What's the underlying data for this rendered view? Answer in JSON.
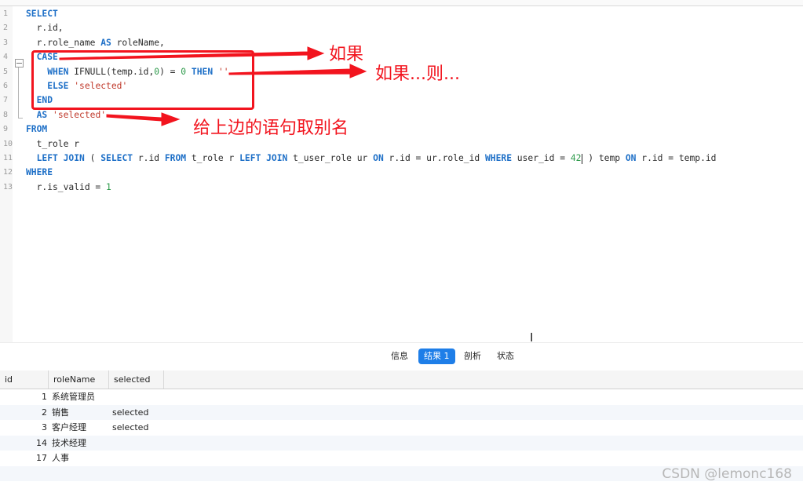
{
  "editor": {
    "lines": [
      {
        "n": "1",
        "segs": [
          {
            "t": "SELECT",
            "c": "kw"
          }
        ]
      },
      {
        "n": "2",
        "segs": [
          {
            "t": "  r.id,",
            "c": ""
          }
        ]
      },
      {
        "n": "3",
        "segs": [
          {
            "t": "  r.role_name ",
            "c": ""
          },
          {
            "t": "AS",
            "c": "kw"
          },
          {
            "t": " roleName,",
            "c": ""
          }
        ]
      },
      {
        "n": "4",
        "segs": [
          {
            "t": "  ",
            "c": ""
          },
          {
            "t": "CASE",
            "c": "kw"
          }
        ]
      },
      {
        "n": "5",
        "segs": [
          {
            "t": "    ",
            "c": ""
          },
          {
            "t": "WHEN",
            "c": "kw"
          },
          {
            "t": " IFNULL(temp.id,",
            "c": ""
          },
          {
            "t": "0",
            "c": "num"
          },
          {
            "t": ") = ",
            "c": ""
          },
          {
            "t": "0",
            "c": "num"
          },
          {
            "t": " ",
            "c": ""
          },
          {
            "t": "THEN",
            "c": "kw"
          },
          {
            "t": " ",
            "c": ""
          },
          {
            "t": "''",
            "c": "str"
          }
        ]
      },
      {
        "n": "6",
        "segs": [
          {
            "t": "    ",
            "c": ""
          },
          {
            "t": "ELSE",
            "c": "kw"
          },
          {
            "t": " ",
            "c": ""
          },
          {
            "t": "'selected'",
            "c": "str"
          }
        ]
      },
      {
        "n": "7",
        "segs": [
          {
            "t": "  ",
            "c": ""
          },
          {
            "t": "END",
            "c": "kw"
          }
        ]
      },
      {
        "n": "8",
        "segs": [
          {
            "t": "  ",
            "c": ""
          },
          {
            "t": "AS",
            "c": "kw"
          },
          {
            "t": " ",
            "c": ""
          },
          {
            "t": "'selected'",
            "c": "str"
          }
        ]
      },
      {
        "n": "9",
        "segs": [
          {
            "t": "FROM",
            "c": "kw"
          }
        ]
      },
      {
        "n": "10",
        "segs": [
          {
            "t": "  t_role r",
            "c": ""
          }
        ]
      },
      {
        "n": "11",
        "segs": [
          {
            "t": "  ",
            "c": ""
          },
          {
            "t": "LEFT JOIN",
            "c": "kw"
          },
          {
            "t": " ( ",
            "c": ""
          },
          {
            "t": "SELECT",
            "c": "kw"
          },
          {
            "t": " r.id ",
            "c": ""
          },
          {
            "t": "FROM",
            "c": "kw"
          },
          {
            "t": " t_role r ",
            "c": ""
          },
          {
            "t": "LEFT JOIN",
            "c": "kw"
          },
          {
            "t": " t_user_role ur ",
            "c": ""
          },
          {
            "t": "ON",
            "c": "kw"
          },
          {
            "t": " r.id = ur.role_id ",
            "c": ""
          },
          {
            "t": "WHERE",
            "c": "kw"
          },
          {
            "t": " user_id = ",
            "c": ""
          },
          {
            "t": "42",
            "c": "num"
          },
          {
            "t": "",
            "c": "cursor"
          },
          {
            "t": " ) temp ",
            "c": ""
          },
          {
            "t": "ON",
            "c": "kw"
          },
          {
            "t": " r.id = temp.id",
            "c": ""
          }
        ]
      },
      {
        "n": "12",
        "segs": [
          {
            "t": "WHERE",
            "c": "kw"
          }
        ]
      },
      {
        "n": "13",
        "segs": [
          {
            "t": "  r.is_valid = ",
            "c": ""
          },
          {
            "t": "1",
            "c": "num"
          }
        ]
      }
    ]
  },
  "annotations": {
    "a1": "如果",
    "a2": "如果...则...",
    "a3": "给上边的语句取别名",
    "color": "#f2141e"
  },
  "tabs": [
    {
      "label": "信息",
      "active": false
    },
    {
      "label": "结果 1",
      "active": true
    },
    {
      "label": "剖析",
      "active": false
    },
    {
      "label": "状态",
      "active": false
    }
  ],
  "grid": {
    "columns": [
      "id",
      "roleName",
      "selected"
    ],
    "rows": [
      {
        "id": "1",
        "roleName": "系统管理员",
        "selected": ""
      },
      {
        "id": "2",
        "roleName": "销售",
        "selected": "selected"
      },
      {
        "id": "3",
        "roleName": "客户经理",
        "selected": "selected"
      },
      {
        "id": "14",
        "roleName": "技术经理",
        "selected": ""
      },
      {
        "id": "17",
        "roleName": "人事",
        "selected": ""
      }
    ]
  },
  "watermark": "CSDN @lemonc168",
  "colors": {
    "keyword": "#1d6fc7",
    "number": "#2e9a4b",
    "string": "#c0392b",
    "accent": "#1e7ee8"
  }
}
